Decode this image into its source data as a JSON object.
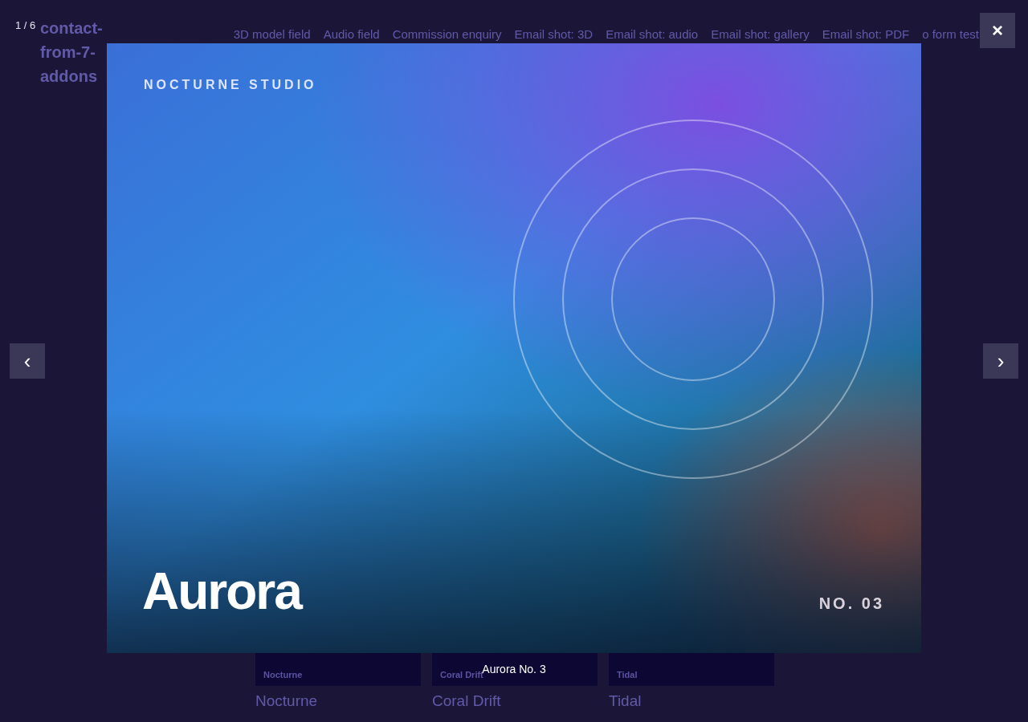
{
  "site": {
    "logo": "contact-from-7-addons",
    "nav": [
      "3D model field",
      "Audio field",
      "Commission enquiry",
      "Email shot: 3D",
      "Email shot: audio",
      "Email shot: gallery",
      "Email shot: PDF",
      "o form test"
    ]
  },
  "gallery": [
    {
      "thumb_title": "Nocturne",
      "label": "Nocturne"
    },
    {
      "thumb_title": "Coral Drift",
      "label": "Coral Drift"
    },
    {
      "thumb_title": "Tidal",
      "label": "Tidal"
    }
  ],
  "lightbox": {
    "counter": "1 / 6",
    "close": "×",
    "prev": "‹",
    "next": "›",
    "image": {
      "kind": "picture",
      "brand": "NOCTURNE STUDIO",
      "title": "Aurora",
      "number": "NO. 03"
    },
    "caption": "Aurora No. 3"
  }
}
